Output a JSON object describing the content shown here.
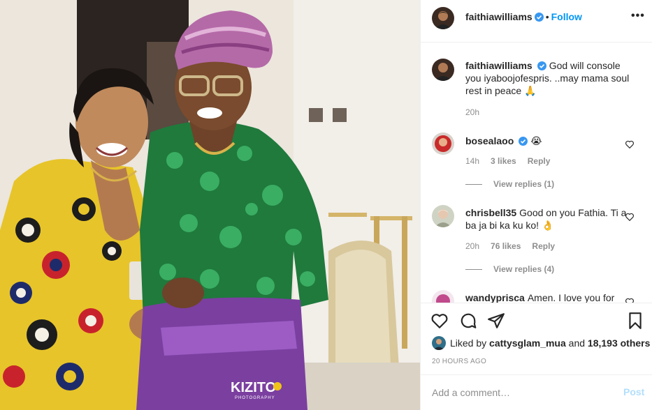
{
  "photo": {
    "alt_subject": "two women in traditional attire",
    "watermark_main": "KIZITO",
    "watermark_sub": "PHOTOGRAPHY"
  },
  "header": {
    "username": "faithiawilliams",
    "separator": "•",
    "follow_label": "Follow",
    "more_label": "•••"
  },
  "caption": {
    "username": "faithiawilliams",
    "text": "God will console you iyaboojofespris. ..may mama soul rest in peace 🙏",
    "time": "20h"
  },
  "comments": [
    {
      "username": "bosealaoo",
      "text": "😭",
      "time": "14h",
      "likes": "3 likes",
      "reply_label": "Reply",
      "view_replies": "View replies (1)",
      "verified": true
    },
    {
      "username": "chrisbell35",
      "text": "Good on you Fathia. Ti a ba ja bi ka ku ko! 👌",
      "time": "20h",
      "likes": "76 likes",
      "reply_label": "Reply",
      "view_replies": "View replies (4)",
      "verified": false
    },
    {
      "username": "wandyprisca",
      "text": "Amen. I love you for",
      "verified": false
    }
  ],
  "actions": {
    "liked_by_prefix": "Liked by",
    "liked_by_user": "cattysglam_mua",
    "liked_by_and": "and",
    "liked_by_others": "18,193 others",
    "time_ago": "20 HOURS AGO"
  },
  "add_comment": {
    "placeholder": "Add a comment…",
    "post_label": "Post"
  },
  "colors": {
    "accent": "#0095f6",
    "verified": "#3897f0",
    "muted": "#8e8e8e",
    "post_disabled": "#b2dffc"
  }
}
